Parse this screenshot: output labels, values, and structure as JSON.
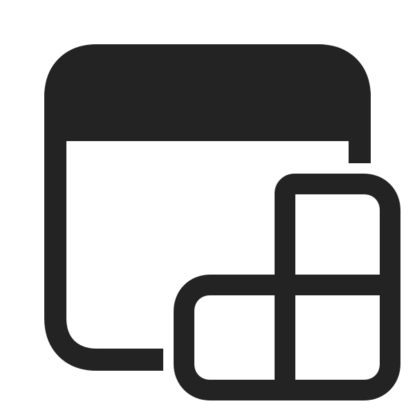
{
  "icon": {
    "name": "app-window-add-apps-icon",
    "description_visible_text": "",
    "colors": {
      "background": "#ffffff",
      "stroke": "#232323",
      "fill": "#232323"
    }
  }
}
